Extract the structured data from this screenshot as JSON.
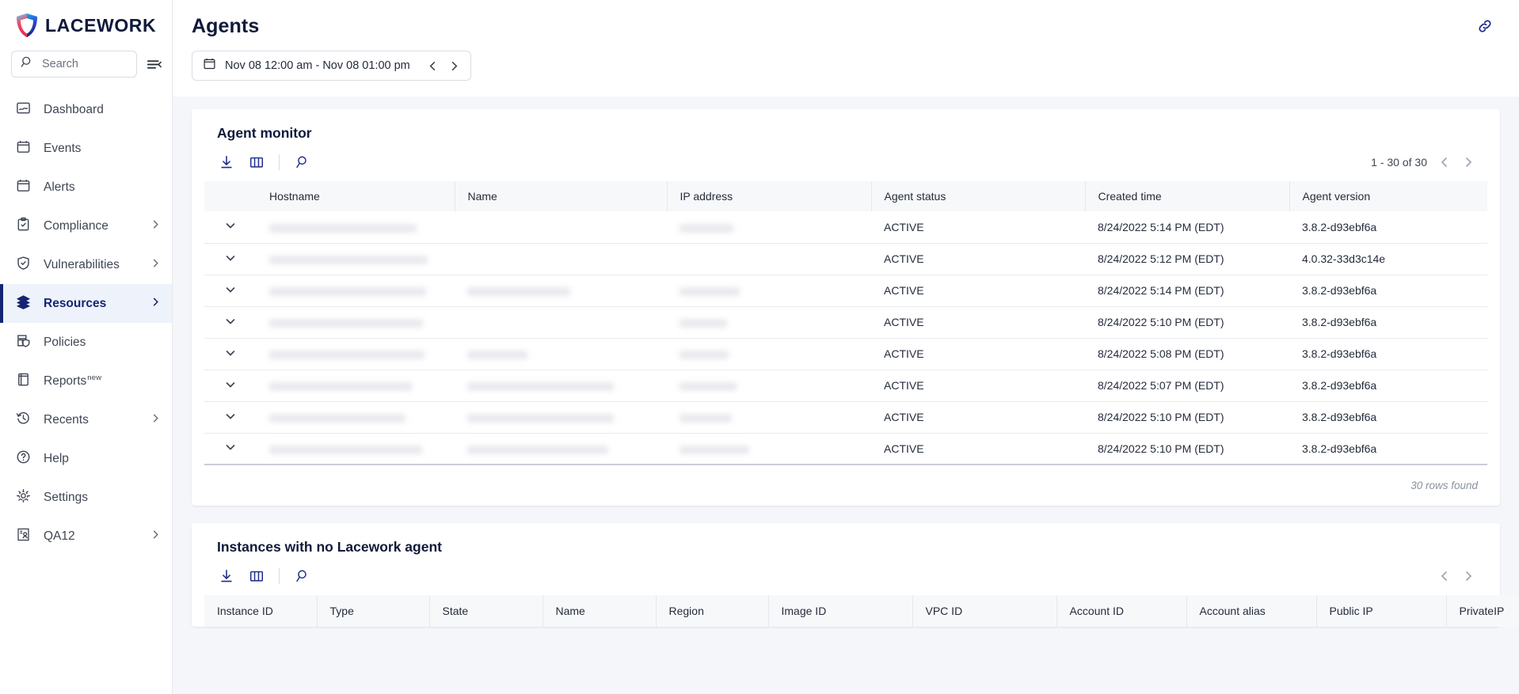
{
  "brand": {
    "name": "LACEWORK",
    "logo_icon": "lacework-shield-logo"
  },
  "sidebar": {
    "search": {
      "placeholder": "Search",
      "value": "",
      "icon": "search-icon"
    },
    "collapse_icon": "collapse-sidebar-icon",
    "items": [
      {
        "label": "Dashboard",
        "icon": "dashboard-icon",
        "active": false,
        "expandable": false
      },
      {
        "label": "Events",
        "icon": "calendar-icon",
        "active": false,
        "expandable": false
      },
      {
        "label": "Alerts",
        "icon": "calendar-alert-icon",
        "active": false,
        "expandable": false
      },
      {
        "label": "Compliance",
        "icon": "clipboard-check-icon",
        "active": false,
        "expandable": true
      },
      {
        "label": "Vulnerabilities",
        "icon": "shield-check-icon",
        "active": false,
        "expandable": true
      },
      {
        "label": "Resources",
        "icon": "layers-icon",
        "active": true,
        "expandable": true
      },
      {
        "label": "Policies",
        "icon": "policy-shield-icon",
        "active": false,
        "expandable": false
      },
      {
        "label": "Reports",
        "badge": "new",
        "icon": "book-icon",
        "active": false,
        "expandable": false
      }
    ],
    "bottom_items": [
      {
        "label": "Recents",
        "icon": "history-clock-icon",
        "expandable": true
      },
      {
        "label": "Help",
        "icon": "question-circle-icon",
        "expandable": false
      },
      {
        "label": "Settings",
        "icon": "gear-icon",
        "expandable": false
      },
      {
        "label": "QA12",
        "icon": "account-id-icon",
        "expandable": true
      }
    ]
  },
  "header": {
    "title": "Agents",
    "link_icon": "link-icon",
    "date_range": {
      "icon": "calendar-icon",
      "text": "Nov 08 12:00 am - Nov 08 01:00 pm",
      "prev_icon": "chevron-left-icon",
      "next_icon": "chevron-right-icon"
    }
  },
  "agent_monitor": {
    "title": "Agent monitor",
    "toolbar": {
      "download_icon": "download-icon",
      "columns_icon": "columns-icon",
      "search_icon": "search-icon"
    },
    "pagination": {
      "text": "1 - 30 of 30",
      "prev_icon": "chevron-left-icon",
      "next_icon": "chevron-right-icon"
    },
    "columns": [
      "Hostname",
      "Name",
      "IP address",
      "Agent status",
      "Created time",
      "Agent version"
    ],
    "rows": [
      {
        "hostname": "",
        "name": "",
        "ip": "",
        "status": "ACTIVE",
        "created": "8/24/2022 5:14 PM (EDT)",
        "version": "3.8.2-d93ebf6a",
        "redacted": {
          "hostname_w": 186,
          "name_w": 0,
          "ip_w": 68
        }
      },
      {
        "hostname": "",
        "name": "",
        "ip": "",
        "status": "ACTIVE",
        "created": "8/24/2022 5:12 PM (EDT)",
        "version": "4.0.32-33d3c14e",
        "redacted": {
          "hostname_w": 200,
          "name_w": 0,
          "ip_w": 0
        }
      },
      {
        "hostname": "",
        "name": "",
        "ip": "",
        "status": "ACTIVE",
        "created": "8/24/2022 5:14 PM (EDT)",
        "version": "3.8.2-d93ebf6a",
        "redacted": {
          "hostname_w": 198,
          "name_w": 130,
          "ip_w": 76
        }
      },
      {
        "hostname": "",
        "name": "",
        "ip": "",
        "status": "ACTIVE",
        "created": "8/24/2022 5:10 PM (EDT)",
        "version": "3.8.2-d93ebf6a",
        "redacted": {
          "hostname_w": 194,
          "name_w": 0,
          "ip_w": 60
        }
      },
      {
        "hostname": "",
        "name": "",
        "ip": "",
        "status": "ACTIVE",
        "created": "8/24/2022 5:08 PM (EDT)",
        "version": "3.8.2-d93ebf6a",
        "redacted": {
          "hostname_w": 196,
          "name_w": 76,
          "ip_w": 62
        }
      },
      {
        "hostname": "",
        "name": "",
        "ip": "",
        "status": "ACTIVE",
        "created": "8/24/2022 5:07 PM (EDT)",
        "version": "3.8.2-d93ebf6a",
        "redacted": {
          "hostname_w": 180,
          "name_w": 185,
          "ip_w": 72
        }
      },
      {
        "hostname": "",
        "name": "",
        "ip": "",
        "status": "ACTIVE",
        "created": "8/24/2022 5:10 PM (EDT)",
        "version": "3.8.2-d93ebf6a",
        "redacted": {
          "hostname_w": 172,
          "name_w": 185,
          "ip_w": 66
        }
      },
      {
        "hostname": "",
        "name": "",
        "ip": "",
        "status": "ACTIVE",
        "created": "8/24/2022 5:10 PM (EDT)",
        "version": "3.8.2-d93ebf6a",
        "redacted": {
          "hostname_w": 193,
          "name_w": 178,
          "ip_w": 88
        }
      }
    ],
    "footer_text": "30 rows found",
    "expand_icon": "chevron-down-icon"
  },
  "instances_no_agent": {
    "title": "Instances with no Lacework agent",
    "toolbar": {
      "download_icon": "download-icon",
      "columns_icon": "columns-icon",
      "search_icon": "search-icon"
    },
    "pagination": {
      "prev_icon": "chevron-left-icon",
      "next_icon": "chevron-right-icon"
    },
    "columns": [
      "Instance ID",
      "Type",
      "State",
      "Name",
      "Region",
      "Image ID",
      "VPC ID",
      "Account ID",
      "Account alias",
      "Public IP",
      "PrivateIP"
    ]
  },
  "colors": {
    "brand_navy": "#152573",
    "accent_blue": "#1b2a8a",
    "page_bg": "#f4f6fa",
    "text_dark": "#10193a",
    "text_body": "#242b3b",
    "border": "#e6e8ec",
    "active_bg": "#eef2fa"
  }
}
